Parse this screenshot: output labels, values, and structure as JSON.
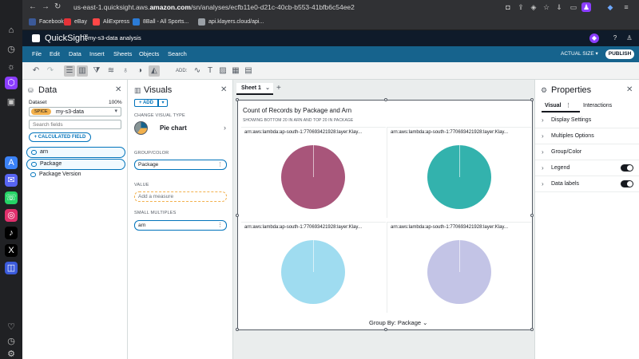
{
  "browser": {
    "url_prefix": "us-east-1.quicksight.aws.",
    "url_domain": "amazon.com",
    "url_path": "/sn/analyses/ecfb11e0-d21c-40cb-b553-41bfb6c54ee2",
    "bookmarks": [
      "Facebook",
      "eBay",
      "AliExpress",
      "8Ball - All Sports...",
      "api.klayers.cloud/api..."
    ]
  },
  "app": {
    "name": "QuickSight",
    "analysis_name": "my-s3-data analysis"
  },
  "menu": {
    "items": [
      "File",
      "Edit",
      "Data",
      "Insert",
      "Sheets",
      "Objects",
      "Search"
    ],
    "actual_size": "ACTUAL SIZE",
    "publish": "PUBLISH"
  },
  "toolbar": {
    "add_label": "ADD:"
  },
  "data_pane": {
    "title": "Data",
    "dataset_label": "Dataset",
    "dataset_pct": "100%",
    "spice_badge": "SPICE",
    "dataset_name": "my-s3-data",
    "search_placeholder": "Search fields",
    "calculated_field": "+ CALCULATED FIELD",
    "fields": [
      "arn",
      "Package",
      "Package Version"
    ]
  },
  "visuals_pane": {
    "title": "Visuals",
    "add": "+ ADD",
    "change_visual_type": "CHANGE VISUAL TYPE",
    "visual_type": "Pie chart",
    "group_color_label": "GROUP/COLOR",
    "group_color_field": "Package",
    "value_label": "VALUE",
    "value_placeholder": "Add a measure",
    "small_multiples_label": "SMALL MULTIPLES",
    "small_multiples_field": "arn"
  },
  "canvas": {
    "sheet_name": "Sheet 1",
    "visual_title": "Count of Records by Package and Arn",
    "visual_subtitle": "SHOWING BOTTOM 20 IN ARN AND TOP 20 IN PACKAGE",
    "group_by": "Group By: Package"
  },
  "chart_data": {
    "type": "pie",
    "title": "Count of Records by Package and Arn",
    "subtitle": "SHOWING BOTTOM 20 IN ARN AND TOP 20 IN PACKAGE",
    "small_multiples": [
      {
        "label": "arn:aws:lambda:ap-south-1:770693421928:layer:Klay...",
        "color": "#a8557a",
        "values": [
          100
        ]
      },
      {
        "label": "arn:aws:lambda:ap-south-1:770693421928:layer:Klay...",
        "color": "#33b2ad",
        "values": [
          100
        ]
      },
      {
        "label": "arn:aws:lambda:ap-south-1:770693421928:layer:Klay...",
        "color": "#9fdcf0",
        "values": [
          100
        ]
      },
      {
        "label": "arn:aws:lambda:ap-south-1:770693421928:layer:Klay...",
        "color": "#c3c4e6",
        "values": [
          100
        ]
      }
    ]
  },
  "properties_pane": {
    "title": "Properties",
    "tabs": [
      "Visual",
      "Interactions"
    ],
    "sections": [
      "Display Settings",
      "Multiples Options",
      "Group/Color",
      "Legend",
      "Data labels"
    ]
  }
}
